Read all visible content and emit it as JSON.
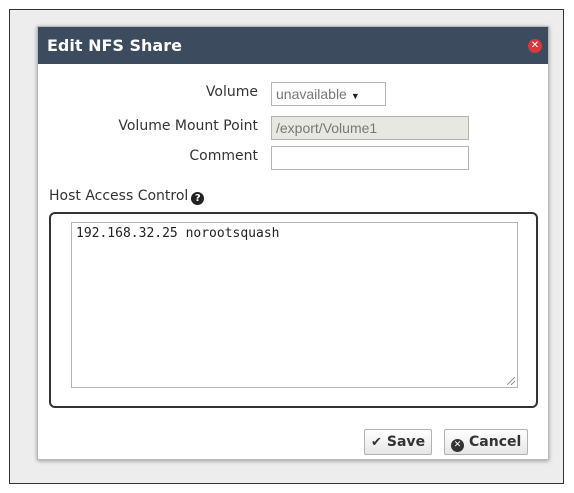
{
  "dialog": {
    "title": "Edit NFS Share",
    "close_icon": "close-circle-icon"
  },
  "form": {
    "volume_label": "Volume",
    "volume_value": "unavailable",
    "mount_point_label": "Volume Mount Point",
    "mount_point_value": "/export/Volume1",
    "comment_label": "Comment",
    "comment_value": "",
    "host_access_label": "Host Access Control",
    "host_access_value": "192.168.32.25 norootsquash"
  },
  "buttons": {
    "save_label": "Save",
    "cancel_label": "Cancel"
  },
  "colors": {
    "titlebar": "#3c4b5d",
    "close": "#d9383c"
  }
}
